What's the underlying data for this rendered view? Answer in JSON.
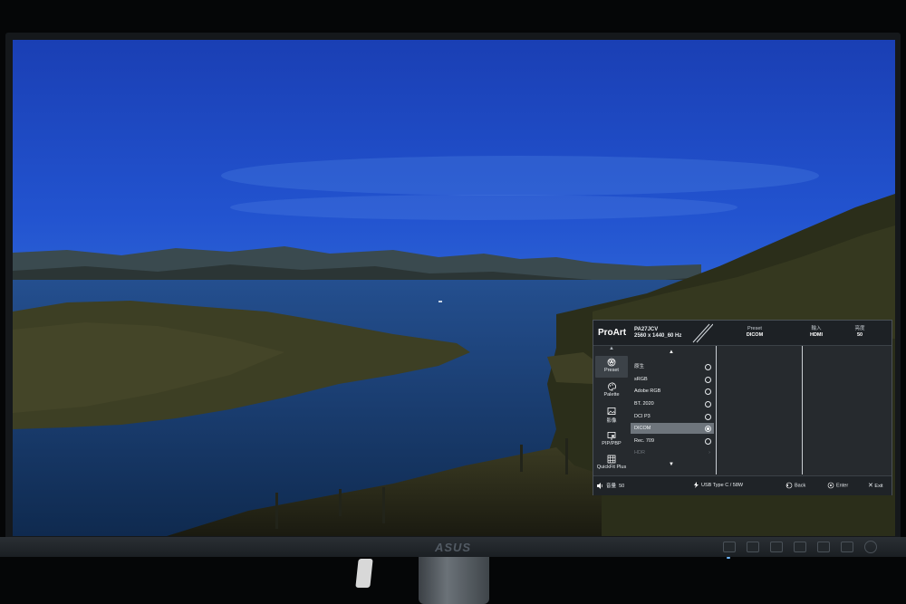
{
  "osd": {
    "logo": "ProArt",
    "model": "PA27JCV",
    "resolution": "2560 x 1440_60 Hz",
    "header": {
      "preset_label": "Preset",
      "preset_value": "DICOM",
      "input_label": "輸入",
      "input_value": "HDMI",
      "brightness_label": "亮度",
      "brightness_value": "50"
    },
    "sidebar": [
      {
        "label": "Preset",
        "icon": "preset-icon",
        "active": true
      },
      {
        "label": "Palette",
        "icon": "palette-icon",
        "active": false
      },
      {
        "label": "影像",
        "icon": "image-icon",
        "active": false
      },
      {
        "label": "PIP/PBP",
        "icon": "pip-icon",
        "active": false
      },
      {
        "label": "QuickFit Plus",
        "icon": "grid-icon",
        "active": false
      }
    ],
    "options": [
      {
        "label": "原生",
        "selected": false,
        "disabled": false
      },
      {
        "label": "sRGB",
        "selected": false,
        "disabled": false
      },
      {
        "label": "Adobe RGB",
        "selected": false,
        "disabled": false
      },
      {
        "label": "BT. 2020",
        "selected": false,
        "disabled": false
      },
      {
        "label": "DCI P3",
        "selected": false,
        "disabled": false
      },
      {
        "label": "DICOM",
        "selected": true,
        "disabled": false
      },
      {
        "label": "Rec. 709",
        "selected": false,
        "disabled": false
      },
      {
        "label": "HDR",
        "selected": false,
        "disabled": true
      }
    ],
    "footer": {
      "volume_label": "音量",
      "volume_value": "50",
      "usb_label": "USB Type C",
      "usb_value": "58W",
      "back": "Back",
      "enter": "Enter",
      "exit": "Exit"
    }
  },
  "monitor": {
    "brand": "ASUS"
  },
  "colors": {
    "osd_bg": "#262a2e",
    "osd_selected": "#6e757c",
    "sky": "#1f55c8"
  }
}
